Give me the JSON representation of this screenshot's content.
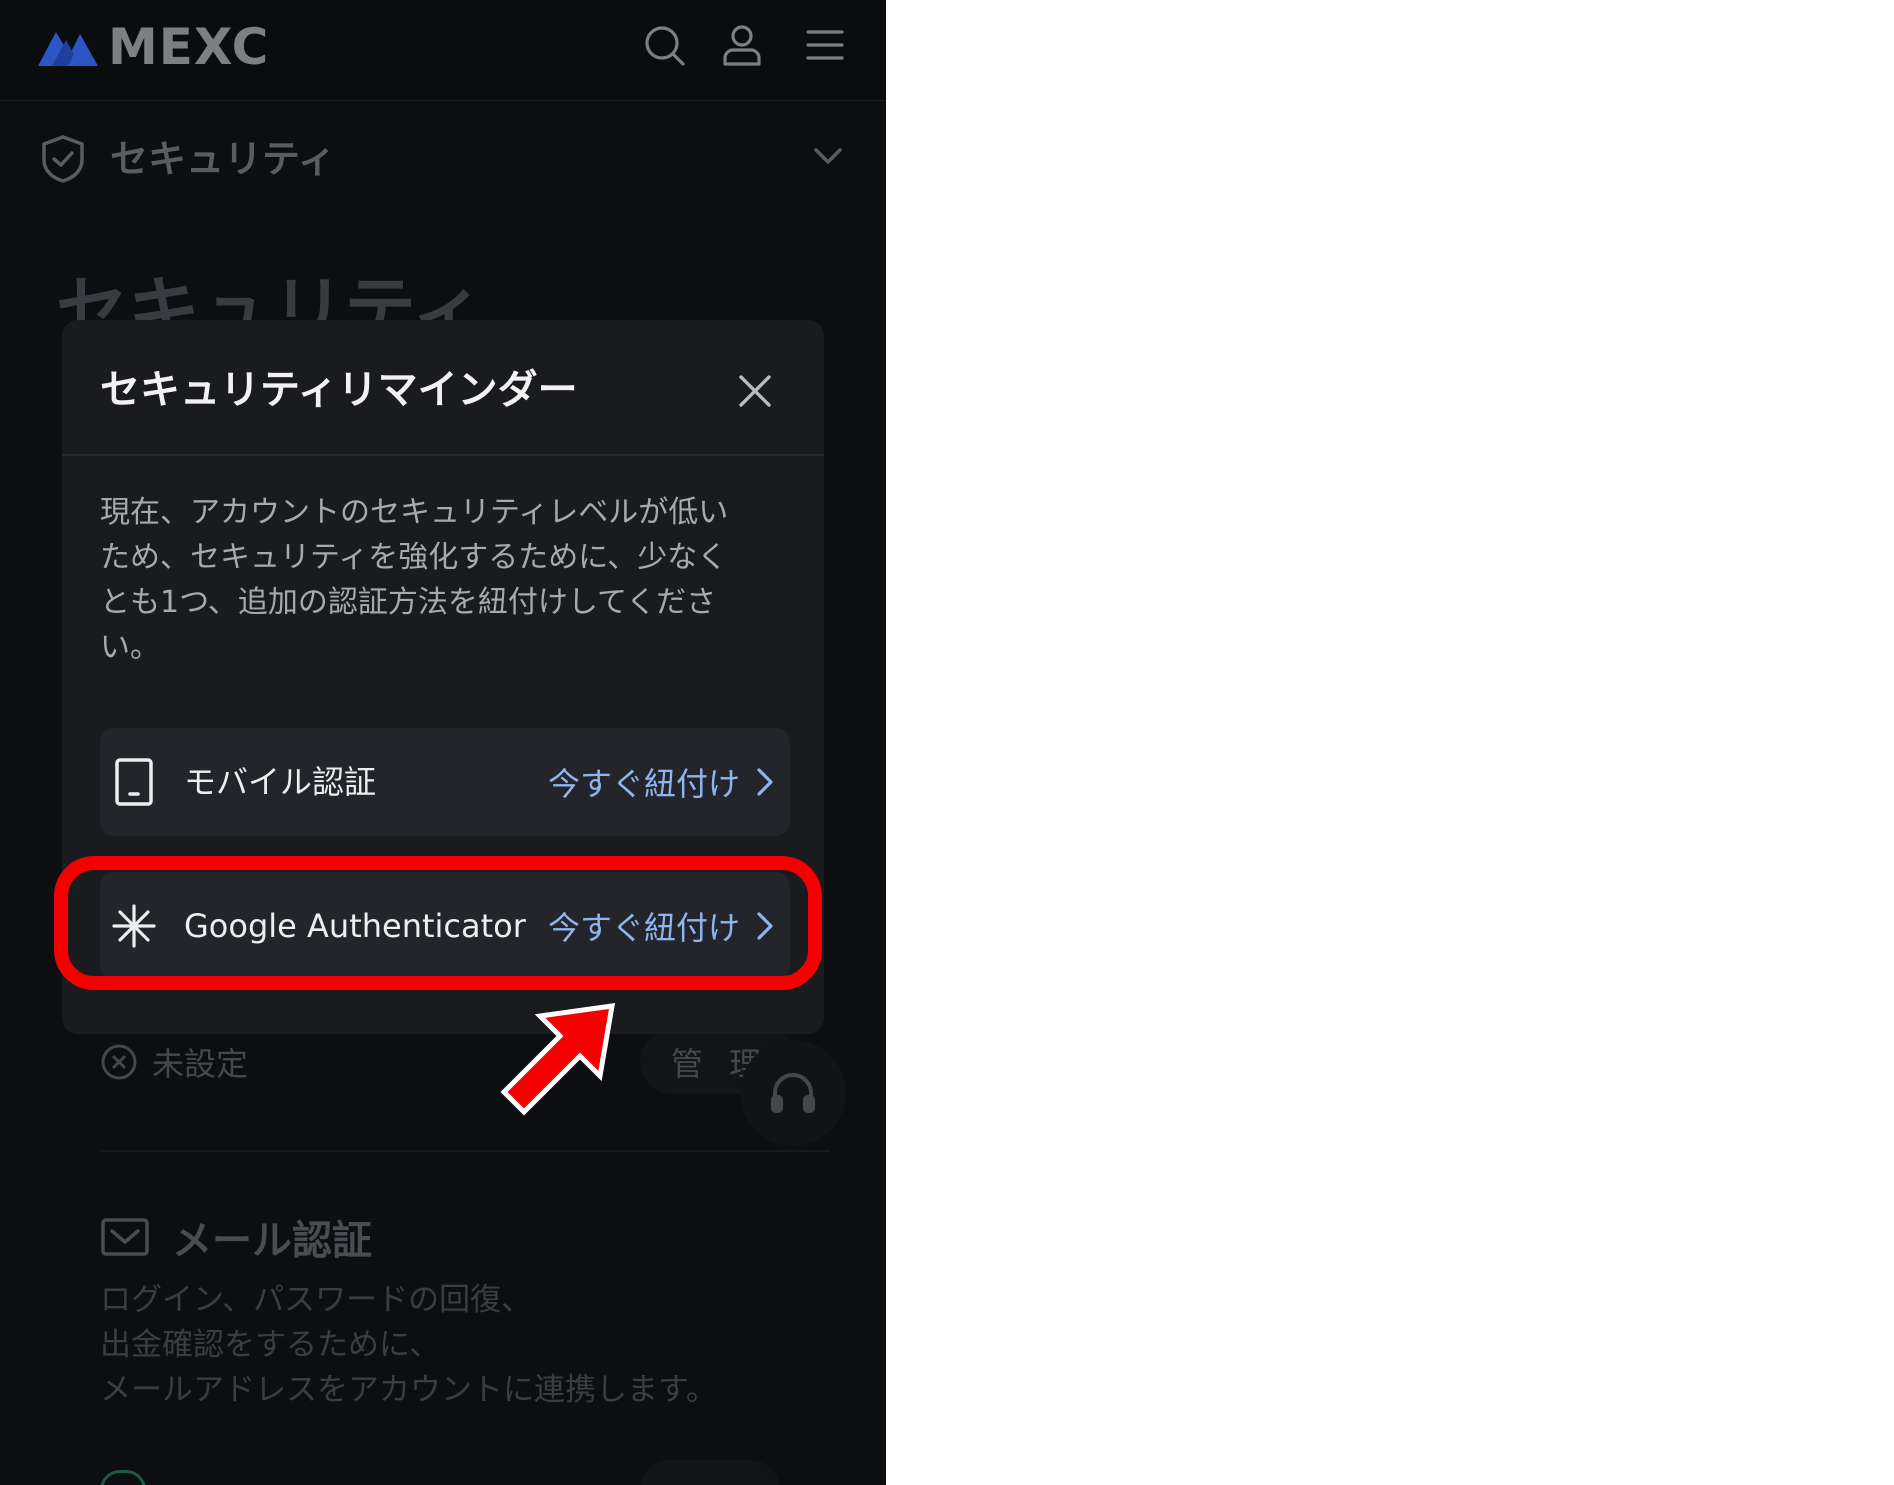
{
  "header": {
    "brand": "MEXC",
    "icons": [
      "search-icon",
      "user-icon",
      "menu-icon"
    ]
  },
  "selector": {
    "label": "セキュリティ",
    "icon": "shield-check-icon"
  },
  "background": {
    "page_title": "セキュリティ",
    "status_text": "未設定",
    "manage_label": "管 理",
    "email_title": "メール認証",
    "email_desc": [
      "ログイン、パスワードの回復、",
      "出金確認をするために、",
      "メールアドレスをアカウントに連携します。"
    ]
  },
  "modal": {
    "title": "セキュリティリマインダー",
    "message_lines": [
      "現在、アカウントのセキュリティレベルが低い",
      "ため、セキュリティを強化するために、少なく",
      "とも1つ、追加の認証方法を紐付けしてくださ",
      "い。"
    ],
    "methods": [
      {
        "label": "モバイル認証",
        "action": "今すぐ紐付け",
        "icon": "mobile-phone-icon"
      },
      {
        "label": "Google Authenticator",
        "action": "今すぐ紐付け",
        "icon": "asterisk-icon"
      }
    ]
  },
  "colors": {
    "accent": "#8fb4ee",
    "highlight": "#f50000",
    "modal_bg": "#1a1b1f",
    "page_bg": "#0d0e11"
  }
}
